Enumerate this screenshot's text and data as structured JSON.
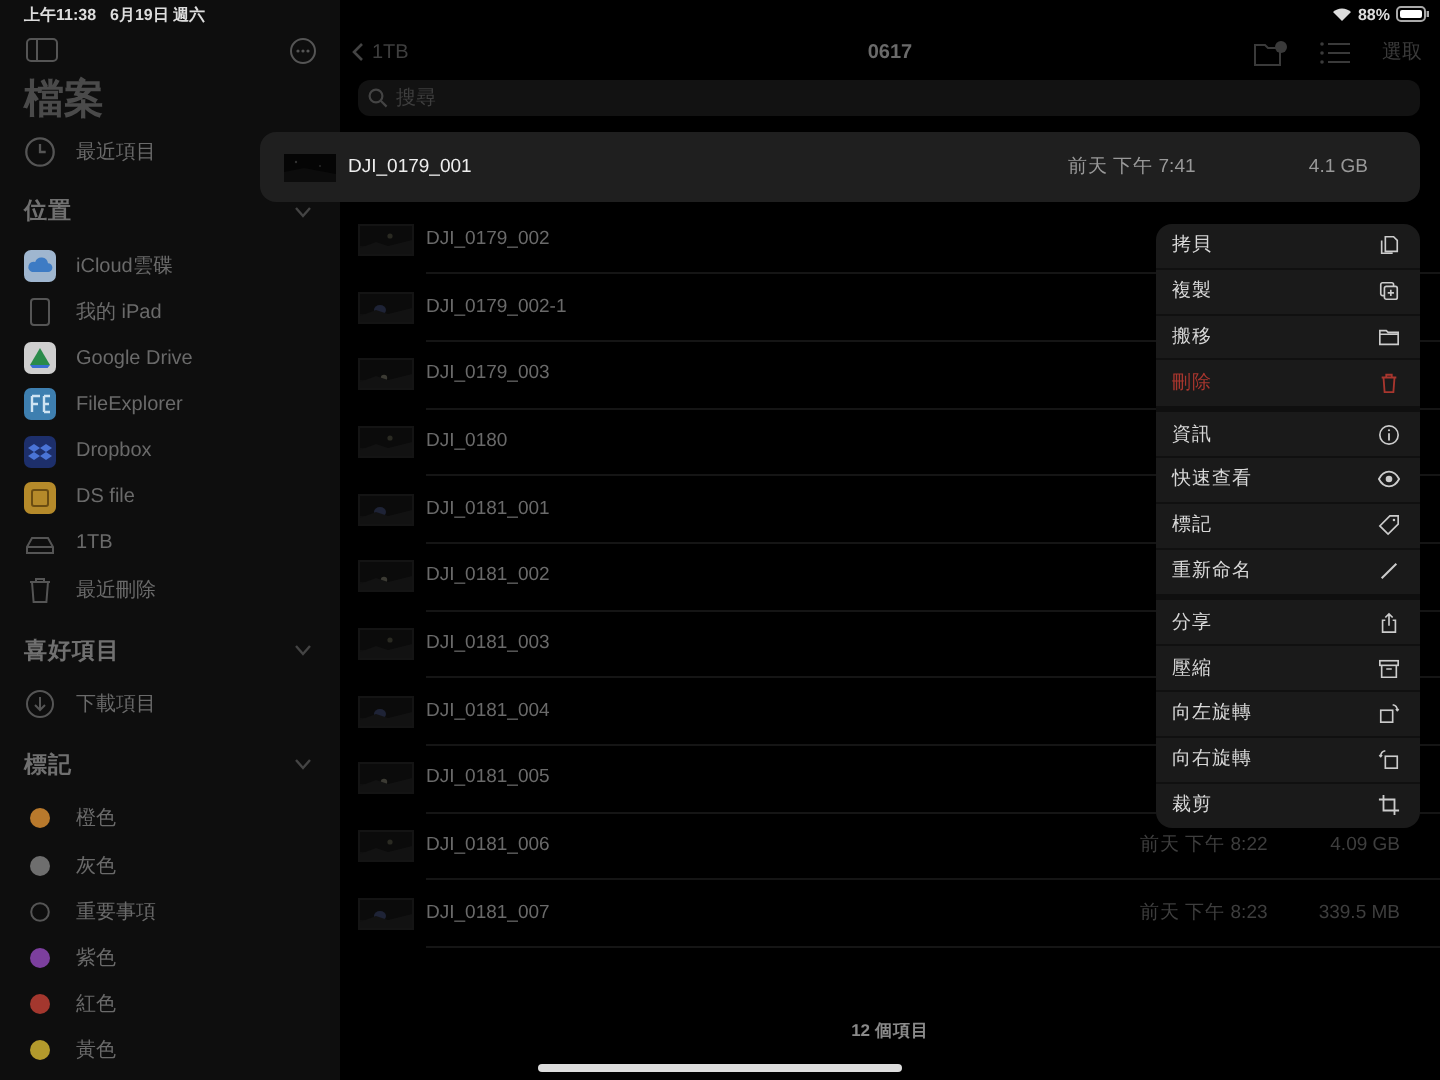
{
  "status_bar": {
    "time": "上午11:38",
    "date": "6月19日 週六",
    "battery": "88%"
  },
  "sidebar": {
    "title": "檔案",
    "recents": {
      "label": "最近項目",
      "kind": "clock"
    },
    "sections": [
      {
        "title": "位置",
        "expanded": true,
        "items": [
          {
            "label": "iCloud雲碟",
            "kind": "icloud"
          },
          {
            "label": "我的 iPad",
            "kind": "ipad"
          },
          {
            "label": "Google Drive",
            "kind": "gdrive"
          },
          {
            "label": "FileExplorer",
            "kind": "fileexplorer"
          },
          {
            "label": "Dropbox",
            "kind": "dropbox"
          },
          {
            "label": "DS file",
            "kind": "dsfile"
          },
          {
            "label": "1TB",
            "kind": "drive"
          },
          {
            "label": "最近刪除",
            "kind": "trash"
          }
        ]
      },
      {
        "title": "喜好項目",
        "expanded": true,
        "items": [
          {
            "label": "下載項目",
            "kind": "download"
          }
        ]
      },
      {
        "title": "標記",
        "expanded": true,
        "items": [
          {
            "label": "橙色",
            "kind": "tag",
            "color": "#b8792c"
          },
          {
            "label": "灰色",
            "kind": "tag",
            "color": "#6e6e6e"
          },
          {
            "label": "重要事項",
            "kind": "tag-empty"
          },
          {
            "label": "紫色",
            "kind": "tag",
            "color": "#7c3f9e"
          },
          {
            "label": "紅色",
            "kind": "tag",
            "color": "#a3372e"
          },
          {
            "label": "黃色",
            "kind": "tag",
            "color": "#b39a2c"
          }
        ]
      }
    ]
  },
  "nav": {
    "back": "1TB",
    "title": "0617",
    "select": "選取"
  },
  "search": {
    "placeholder": "搜尋"
  },
  "files": [
    {
      "name": "DJI_0179_001",
      "date": "前天 下午 7:41",
      "size": "4.1 GB",
      "selected": true
    },
    {
      "name": "DJI_0179_002",
      "selected": false
    },
    {
      "name": "DJI_0179_002-1",
      "selected": false
    },
    {
      "name": "DJI_0179_003",
      "selected": false
    },
    {
      "name": "DJI_0180",
      "selected": false
    },
    {
      "name": "DJI_0181_001",
      "selected": false
    },
    {
      "name": "DJI_0181_002",
      "selected": false
    },
    {
      "name": "DJI_0181_003",
      "selected": false
    },
    {
      "name": "DJI_0181_004",
      "selected": false
    },
    {
      "name": "DJI_0181_005",
      "selected": false
    },
    {
      "name": "DJI_0181_006",
      "date": "前天 下午 8:22",
      "size": "4.09 GB",
      "selected": false
    },
    {
      "name": "DJI_0181_007",
      "date": "前天 下午 8:23",
      "size": "339.5 MB",
      "selected": false
    }
  ],
  "context_menu": [
    [
      {
        "label": "拷貝",
        "kind": "copy"
      },
      {
        "label": "複製",
        "kind": "duplicate"
      },
      {
        "label": "搬移",
        "kind": "move"
      },
      {
        "label": "刪除",
        "kind": "delete"
      }
    ],
    [
      {
        "label": "資訊",
        "kind": "info"
      },
      {
        "label": "快速查看",
        "kind": "quicklook"
      },
      {
        "label": "標記",
        "kind": "tag"
      },
      {
        "label": "重新命名",
        "kind": "rename"
      }
    ],
    [
      {
        "label": "分享",
        "kind": "share"
      },
      {
        "label": "壓縮",
        "kind": "compress"
      },
      {
        "label": "向左旋轉",
        "kind": "rotate-left"
      },
      {
        "label": "向右旋轉",
        "kind": "rotate-right"
      },
      {
        "label": "裁剪",
        "kind": "crop"
      }
    ]
  ],
  "footer": "12 個項目"
}
